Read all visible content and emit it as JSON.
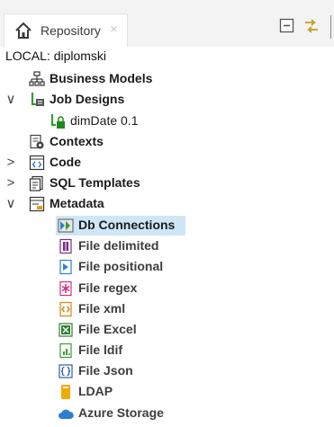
{
  "tab": {
    "title": "Repository",
    "close": "×"
  },
  "root_label": "LOCAL: diplomski",
  "tree": {
    "business_models": "Business Models",
    "job_designs": "Job Designs",
    "job_dimdate": "dimDate 0.1",
    "contexts": "Contexts",
    "code": "Code",
    "sql_templates": "SQL Templates",
    "metadata": "Metadata",
    "meta": {
      "db_connections": "Db Connections",
      "file_delimited": "File delimited",
      "file_positional": "File positional",
      "file_regex": "File regex",
      "file_xml": "File xml",
      "file_excel": "File Excel",
      "file_ldif": "File ldif",
      "file_json": "File Json",
      "ldap": "LDAP",
      "azure_storage": "Azure Storage"
    }
  },
  "arrows": {
    "expanded": "∨",
    "collapsed": ">"
  },
  "selected_item": "Db Connections",
  "colors": {
    "selection": "#cfe6f8",
    "accent_blue": "#2f7fd1",
    "accent_green": "#3a9a3a"
  }
}
